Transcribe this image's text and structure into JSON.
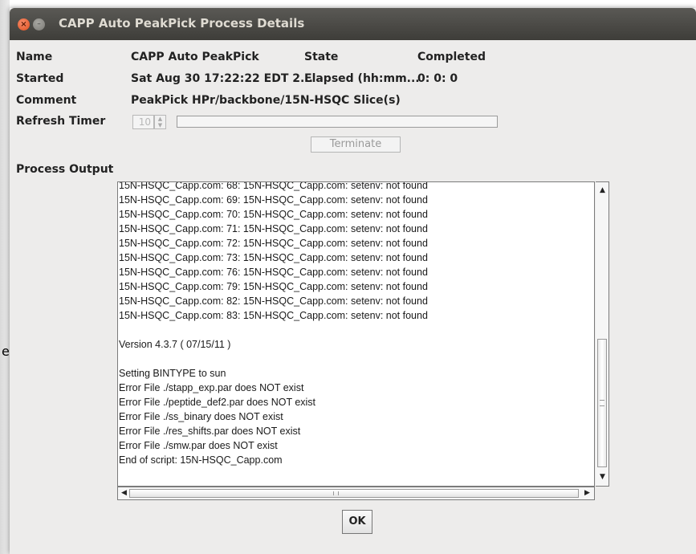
{
  "window": {
    "title": "CAPP Auto PeakPick Process Details",
    "close_glyph": "×",
    "minimize_glyph": "–"
  },
  "background": {
    "stray_text": "e"
  },
  "details": {
    "name_label": "Name",
    "name_value": "CAPP Auto PeakPick",
    "state_label": "State",
    "state_value": "Completed",
    "started_label": "Started",
    "started_value": "Sat Aug 30 17:22:22 EDT 2...",
    "elapsed_label": "Elapsed (hh:mm...",
    "elapsed_value": "0: 0: 0",
    "comment_label": "Comment",
    "comment_value": "PeakPick HPr/backbone/15N-HSQC Slice(s)",
    "refresh_label": "Refresh Timer",
    "refresh_value": "10",
    "terminate_label": "Terminate",
    "progress": 0
  },
  "output": {
    "label": "Process Output",
    "text": "15N-HSQC_Capp.com: 68: 15N-HSQC_Capp.com: setenv: not found\n15N-HSQC_Capp.com: 69: 15N-HSQC_Capp.com: setenv: not found\n15N-HSQC_Capp.com: 70: 15N-HSQC_Capp.com: setenv: not found\n15N-HSQC_Capp.com: 71: 15N-HSQC_Capp.com: setenv: not found\n15N-HSQC_Capp.com: 72: 15N-HSQC_Capp.com: setenv: not found\n15N-HSQC_Capp.com: 73: 15N-HSQC_Capp.com: setenv: not found\n15N-HSQC_Capp.com: 76: 15N-HSQC_Capp.com: setenv: not found\n15N-HSQC_Capp.com: 79: 15N-HSQC_Capp.com: setenv: not found\n15N-HSQC_Capp.com: 82: 15N-HSQC_Capp.com: setenv: not found\n15N-HSQC_Capp.com: 83: 15N-HSQC_Capp.com: setenv: not found\n\nVersion 4.3.7 ( 07/15/11 )\n\nSetting BINTYPE to sun\nError File ./stapp_exp.par does NOT exist\nError File ./peptide_def2.par does NOT exist\nError File ./ss_binary does NOT exist\nError File ./res_shifts.par does NOT exist\nError File ./smw.par does NOT exist\nEnd of script: 15N-HSQC_Capp.com"
  },
  "scroll_arrows": {
    "up": "▲",
    "down": "▼",
    "left": "◀",
    "right": "▶"
  },
  "buttons": {
    "ok_label": "OK"
  },
  "icons": {
    "close": "close-icon",
    "minimize": "minimize-icon"
  }
}
